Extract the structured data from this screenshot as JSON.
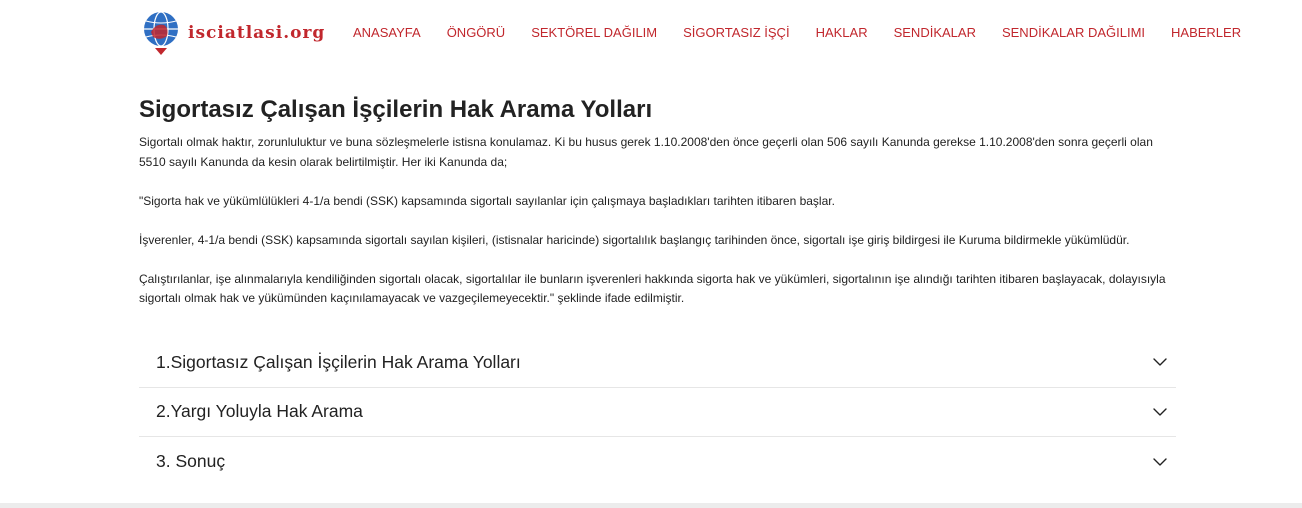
{
  "brand": {
    "name": "isciatlasi.org"
  },
  "nav": {
    "items": [
      {
        "label": "ANASAYFA"
      },
      {
        "label": "ÖNGÖRÜ"
      },
      {
        "label": "SEKTÖREL DAĞILIM"
      },
      {
        "label": "SİGORTASIZ İŞÇİ"
      },
      {
        "label": "HAKLAR"
      },
      {
        "label": "SENDİKALAR"
      },
      {
        "label": "SENDİKALAR DAĞILIMI"
      },
      {
        "label": "HABERLER"
      }
    ]
  },
  "main": {
    "title": "Sigortasız Çalışan İşçilerin Hak Arama Yolları",
    "paragraphs": [
      "Sigortalı olmak haktır, zorunluluktur ve buna sözleşmelerle istisna konulamaz. Ki bu husus gerek 1.10.2008'den önce geçerli olan 506 sayılı Kanunda gerekse 1.10.2008'den sonra geçerli olan 5510 sayılı Kanunda da kesin olarak belirtilmiştir. Her iki Kanunda da;",
      "\"Sigorta hak ve yükümlülükleri 4-1/a bendi (SSK) kapsamında sigortalı sayılanlar için çalışmaya başladıkları tarihten itibaren başlar.",
      "İşverenler, 4-1/a bendi (SSK) kapsamında sigortalı sayılan kişileri, (istisnalar haricinde) sigortalılık başlangıç tarihinden önce, sigortalı işe giriş bildirgesi ile Kuruma bildirmekle yükümlüdür.",
      "Çalıştırılanlar, işe alınmalarıyla kendiliğinden sigortalı olacak, sigortalılar ile bunların işverenleri hakkında sigorta hak ve yükümleri, sigortalının işe alındığı tarihten itibaren başlayacak, dolayısıyla sigortalı olmak hak ve yükümünden kaçınılamayacak ve vazgeçilemeyecektir.\" şeklinde ifade edilmiştir."
    ],
    "accordion": [
      {
        "label": "1.Sigortasız Çalışan İşçilerin Hak Arama Yolları",
        "icon": "chevron-down-icon"
      },
      {
        "label": "2.Yargı Yoluyla Hak Arama",
        "icon": "chevron-down-icon"
      },
      {
        "label": "3. Sonuç",
        "icon": "chevron-down-icon"
      }
    ]
  },
  "colors": {
    "accent": "#c1272d",
    "text": "#222222",
    "background": "#ffffff",
    "divider": "#e6e6e6"
  }
}
